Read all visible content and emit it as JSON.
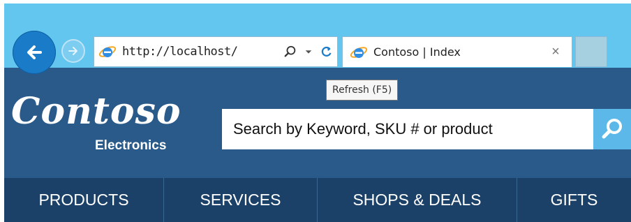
{
  "browser": {
    "address_url": "http://localhost/",
    "tab_title": "Contoso | Index",
    "tab_close": "×",
    "tooltip": "Refresh (F5)"
  },
  "site": {
    "logo_word": "Contoso",
    "logo_sub": "Electronics",
    "search_placeholder": "Search by Keyword, SKU # or product",
    "nav": [
      {
        "label": "PRODUCTS"
      },
      {
        "label": "SERVICES"
      },
      {
        "label": "SHOPS & DEALS"
      },
      {
        "label": "GIFTS"
      }
    ]
  },
  "colors": {
    "chrome": "#62c6ee",
    "header": "#295a89",
    "nav": "#1c4168",
    "search_button": "#5bb8e9"
  },
  "icons": [
    "back-arrow-icon",
    "forward-arrow-icon",
    "ie-logo-icon",
    "search-icon",
    "dropdown-icon",
    "refresh-icon",
    "close-icon"
  ]
}
